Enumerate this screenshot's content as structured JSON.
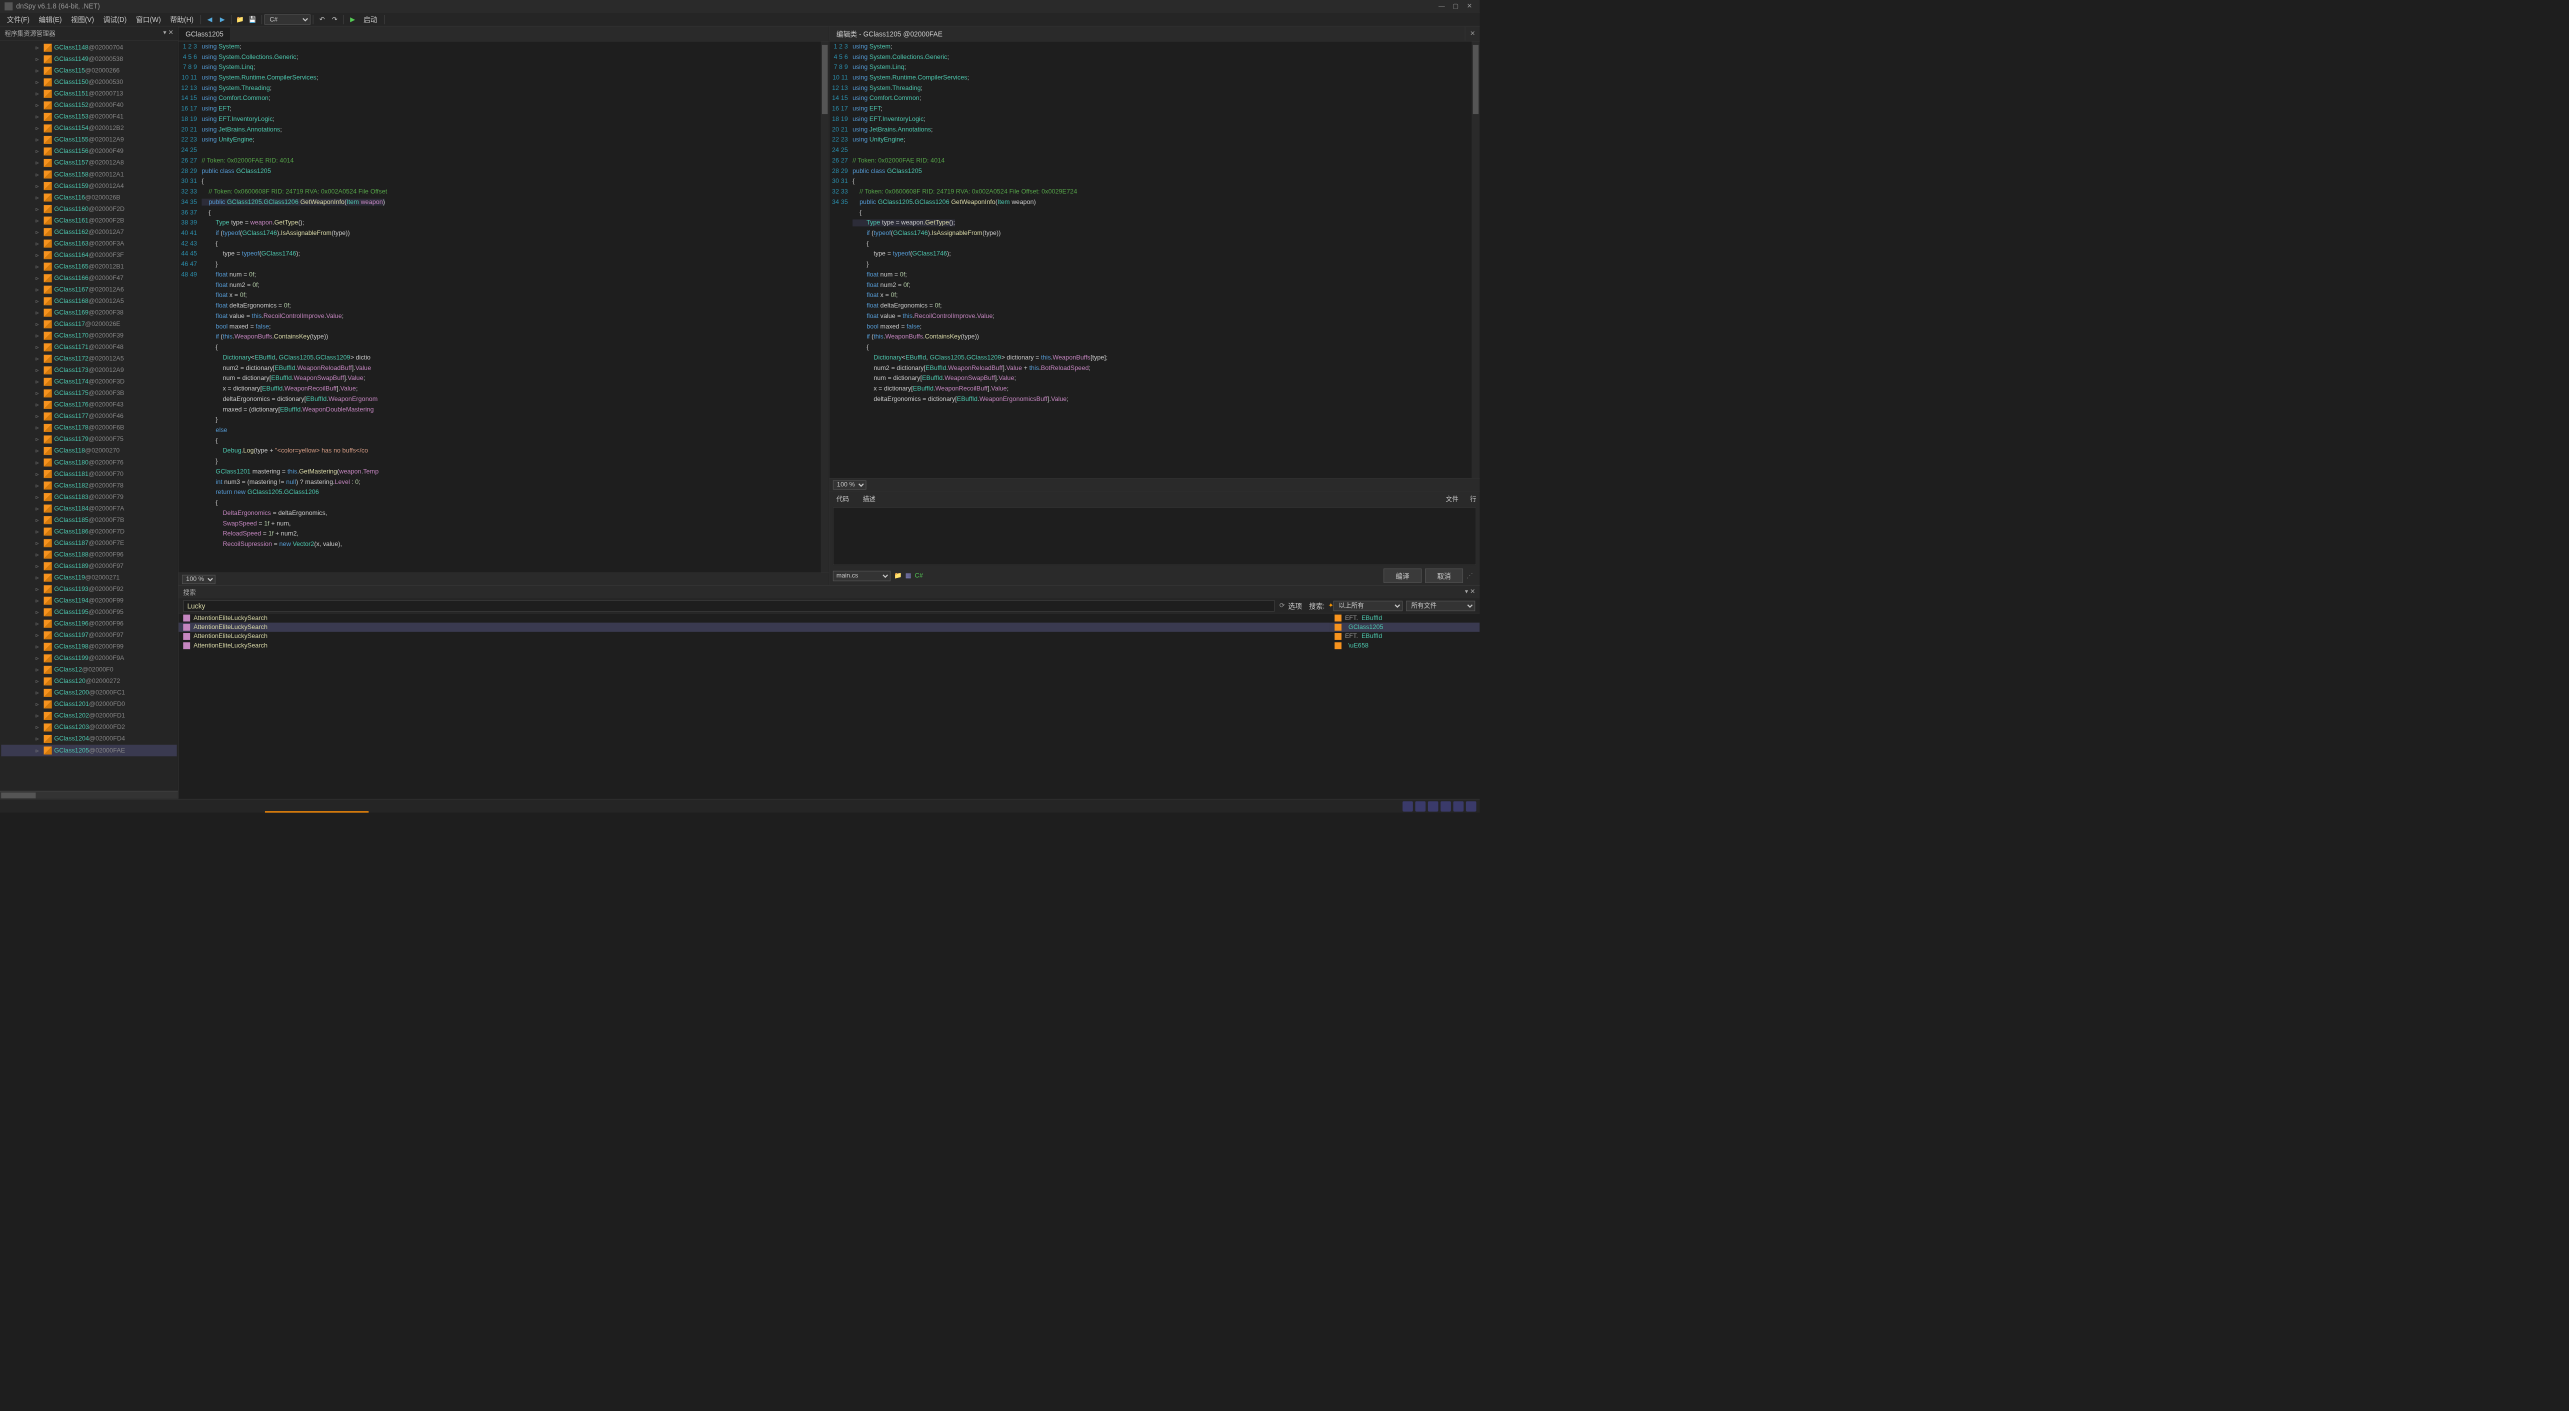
{
  "app": {
    "title": "dnSpy v6.1.8 (64-bit, .NET)"
  },
  "menus": [
    "文件(F)",
    "编辑(E)",
    "视图(V)",
    "调试(D)",
    "窗口(W)",
    "帮助(H)"
  ],
  "toolbar": {
    "lang": "C#",
    "start": "启动"
  },
  "sidebar": {
    "title": "程序集资源管理器",
    "items": [
      {
        "n": "GClass1148",
        "t": "@02000704"
      },
      {
        "n": "GClass1149",
        "t": "@02000538"
      },
      {
        "n": "GClass115",
        "t": "@02000266"
      },
      {
        "n": "GClass1150",
        "t": "@02000530"
      },
      {
        "n": "GClass1151",
        "t": "@02000713"
      },
      {
        "n": "GClass1152",
        "t": "@02000F40"
      },
      {
        "n": "GClass1153",
        "t": "@02000F41"
      },
      {
        "n": "GClass1154",
        "t": "@020012B2"
      },
      {
        "n": "GClass1155",
        "t": "@020012A9"
      },
      {
        "n": "GClass1156",
        "t": "@02000F49"
      },
      {
        "n": "GClass1157",
        "t": "@020012A8"
      },
      {
        "n": "GClass1158",
        "t": "@020012A1"
      },
      {
        "n": "GClass1159",
        "t": "@020012A4"
      },
      {
        "n": "GClass116",
        "t": "@0200026B"
      },
      {
        "n": "GClass1160",
        "t": "@02000F2D"
      },
      {
        "n": "GClass1161",
        "t": "@02000F2B"
      },
      {
        "n": "GClass1162",
        "t": "@020012A7"
      },
      {
        "n": "GClass1163",
        "t": "@02000F3A"
      },
      {
        "n": "GClass1164",
        "t": "@02000F3F"
      },
      {
        "n": "GClass1165",
        "t": "@020012B1"
      },
      {
        "n": "GClass1166",
        "t": "@02000F47"
      },
      {
        "n": "GClass1167",
        "t": "@020012A6"
      },
      {
        "n": "GClass1168",
        "t": "@020012A5"
      },
      {
        "n": "GClass1169",
        "t": "@02000F38"
      },
      {
        "n": "GClass117",
        "t": "@0200026E"
      },
      {
        "n": "GClass1170",
        "t": "@02000F39"
      },
      {
        "n": "GClass1171",
        "t": "@02000F48"
      },
      {
        "n": "GClass1172",
        "t": "@020012A5"
      },
      {
        "n": "GClass1173",
        "t": "@020012A9"
      },
      {
        "n": "GClass1174",
        "t": "@02000F3D"
      },
      {
        "n": "GClass1175",
        "t": "@02000F3B"
      },
      {
        "n": "GClass1176",
        "t": "@02000F43"
      },
      {
        "n": "GClass1177",
        "t": "@02000F46"
      },
      {
        "n": "GClass1178",
        "t": "@02000F6B"
      },
      {
        "n": "GClass1179",
        "t": "@02000F75"
      },
      {
        "n": "GClass118",
        "t": "@02000270"
      },
      {
        "n": "GClass1180",
        "t": "@02000F76"
      },
      {
        "n": "GClass1181",
        "t": "@02000F70"
      },
      {
        "n": "GClass1182",
        "t": "@02000F78"
      },
      {
        "n": "GClass1183",
        "t": "@02000F79"
      },
      {
        "n": "GClass1184",
        "t": "@02000F7A"
      },
      {
        "n": "GClass1185",
        "t": "@02000F7B"
      },
      {
        "n": "GClass1186",
        "t": "@02000F7D"
      },
      {
        "n": "GClass1187",
        "t": "@02000F7E"
      },
      {
        "n": "GClass1188",
        "t": "@02000F96"
      },
      {
        "n": "GClass1189",
        "t": "@02000F97"
      },
      {
        "n": "GClass119",
        "t": "@02000271"
      },
      {
        "n": "GClass1193",
        "t": "@02000F92"
      },
      {
        "n": "GClass1194",
        "t": "@02000F99"
      },
      {
        "n": "GClass1195",
        "t": "@02000F95"
      },
      {
        "n": "GClass1196",
        "t": "@02000F96"
      },
      {
        "n": "GClass1197",
        "t": "@02000F97"
      },
      {
        "n": "GClass1198",
        "t": "@02000F99"
      },
      {
        "n": "GClass1199",
        "t": "@02000F9A"
      },
      {
        "n": "GClass12",
        "t": "@02000F0"
      },
      {
        "n": "GClass120",
        "t": "@02000272"
      },
      {
        "n": "GClass1200",
        "t": "@02000FC1"
      },
      {
        "n": "GClass1201",
        "t": "@02000FD0"
      },
      {
        "n": "GClass1202",
        "t": "@02000FD1"
      },
      {
        "n": "GClass1203",
        "t": "@02000FD2"
      },
      {
        "n": "GClass1204",
        "t": "@02000FD4"
      },
      {
        "n": "GClass1205",
        "t": "@02000FAE",
        "sel": true
      }
    ]
  },
  "editor1": {
    "tab": "GClass1205",
    "zoom": "100 %"
  },
  "editor2": {
    "tab": "编辑类 - GClass1205 @02000FAE",
    "zoom": "100 %",
    "bottom_tabs": [
      "代码",
      "描述"
    ],
    "cols": [
      "文件",
      "行"
    ],
    "file_select": "main.cs",
    "compile": "编译",
    "cancel": "取消"
  },
  "search": {
    "title": "搜索",
    "input": "Lucky",
    "opt_label": "选项",
    "search_label": "搜索:",
    "scope1": "以上所有",
    "scope2": "所有文件",
    "results": [
      "AttentionEliteLuckySearch",
      "AttentionEliteLuckySearch",
      "AttentionEliteLuckySearch",
      "AttentionEliteLuckySearch"
    ],
    "results2": [
      {
        "ns": "EFT.",
        "n": "EBuffId"
      },
      {
        "ns": "",
        "n": "GClass1205"
      },
      {
        "ns": "EFT.",
        "n": "EBuffId"
      },
      {
        "ns": "",
        "n": "\\uE658"
      }
    ]
  }
}
